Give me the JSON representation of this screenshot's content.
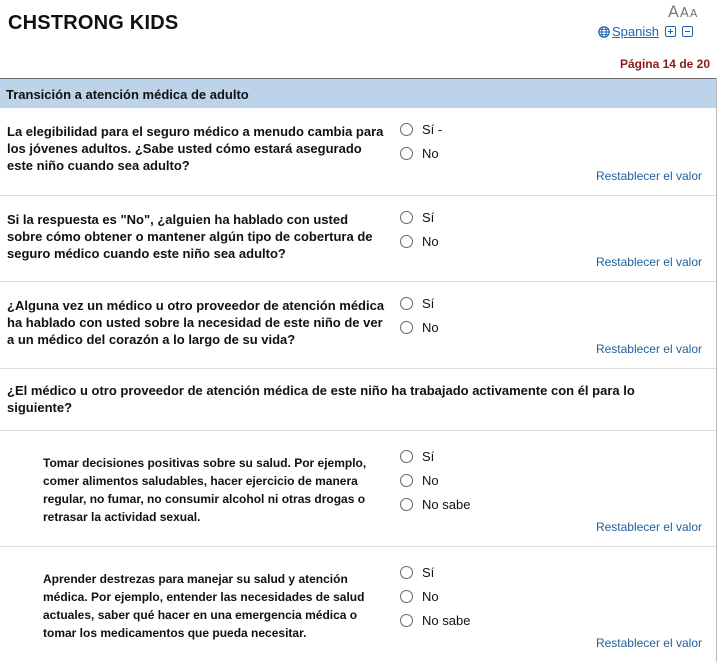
{
  "app": {
    "title": "CHSTRONG KIDS"
  },
  "text_size": {
    "large": "A",
    "medium": "A",
    "small": "A"
  },
  "language": {
    "link_label": "Spanish"
  },
  "page_indicator": "Página 14 de 20",
  "section": {
    "title": "Transición a atención médica de adulto"
  },
  "reset_label": "Restablecer el valor",
  "questions": [
    {
      "text": "La elegibilidad para el seguro médico a menudo cambia para los jóvenes adultos. ¿Sabe usted cómo estará asegurado este niño cuando sea adulto?",
      "options": [
        "Sí -",
        "No"
      ]
    },
    {
      "text": "Si la respuesta es \"No\", ¿alguien ha hablado con usted sobre cómo obtener o mantener algún tipo de cobertura de seguro médico cuando este niño sea adulto?",
      "options": [
        "Sí",
        "No"
      ]
    },
    {
      "text": "¿Alguna vez un médico u otro proveedor de atención médica ha hablado con usted sobre la necesidad de este niño de ver a un médico del corazón a lo largo de su vida?",
      "options": [
        "Sí",
        "No"
      ]
    }
  ],
  "group_question": {
    "text": "¿El médico u otro proveedor de atención médica de este niño ha trabajado activamente con él para lo siguiente?"
  },
  "sub_questions": [
    {
      "text": "Tomar decisiones positivas sobre su salud. Por ejemplo, comer alimentos saludables, hacer ejercicio de manera regular, no fumar, no consumir alcohol ni otras drogas o retrasar la actividad sexual.",
      "options": [
        "Sí",
        "No",
        "No sabe"
      ]
    },
    {
      "text": "Aprender destrezas para manejar su salud y atención médica. Por ejemplo, entender las necesidades de salud actuales, saber qué hacer en una emergencia médica o tomar los medicamentos que pueda necesitar.",
      "options": [
        "Sí",
        "No",
        "No sabe"
      ]
    }
  ]
}
